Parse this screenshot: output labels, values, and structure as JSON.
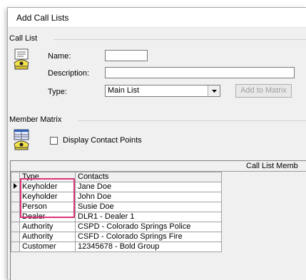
{
  "window": {
    "title": "Add Call Lists"
  },
  "call_list": {
    "group_label": "Call List",
    "icon": "phone-book-icon",
    "name_label": "Name:",
    "name_value": "",
    "description_label": "Description:",
    "description_value": "",
    "type_label": "Type:",
    "type_value": "Main List",
    "add_button": "Add to Matrix"
  },
  "member_matrix": {
    "group_label": "Member Matrix",
    "icon": "phone-list-icon",
    "display_contact_points_label": "Display Contact Points",
    "display_contact_points_checked": false
  },
  "grid": {
    "caption": "Call List Memb",
    "columns": [
      "Type",
      "Contacts"
    ],
    "rows": [
      {
        "type": "Keyholder",
        "contact": "Jane Doe",
        "current": true
      },
      {
        "type": "Keyholder",
        "contact": "John Doe",
        "current": false
      },
      {
        "type": "Person",
        "contact": "Susie Doe",
        "current": false
      },
      {
        "type": "Dealer",
        "contact": "DLR1 - Dealer 1",
        "current": false
      },
      {
        "type": "Authority",
        "contact": "CSPD - Colorado Springs Police",
        "current": false
      },
      {
        "type": "Authority",
        "contact": "CSFD - Colorado Springs Fire",
        "current": false
      },
      {
        "type": "Customer",
        "contact": "12345678 - Bold Group",
        "current": false
      }
    ]
  },
  "colors": {
    "highlight": "#e0337a"
  }
}
